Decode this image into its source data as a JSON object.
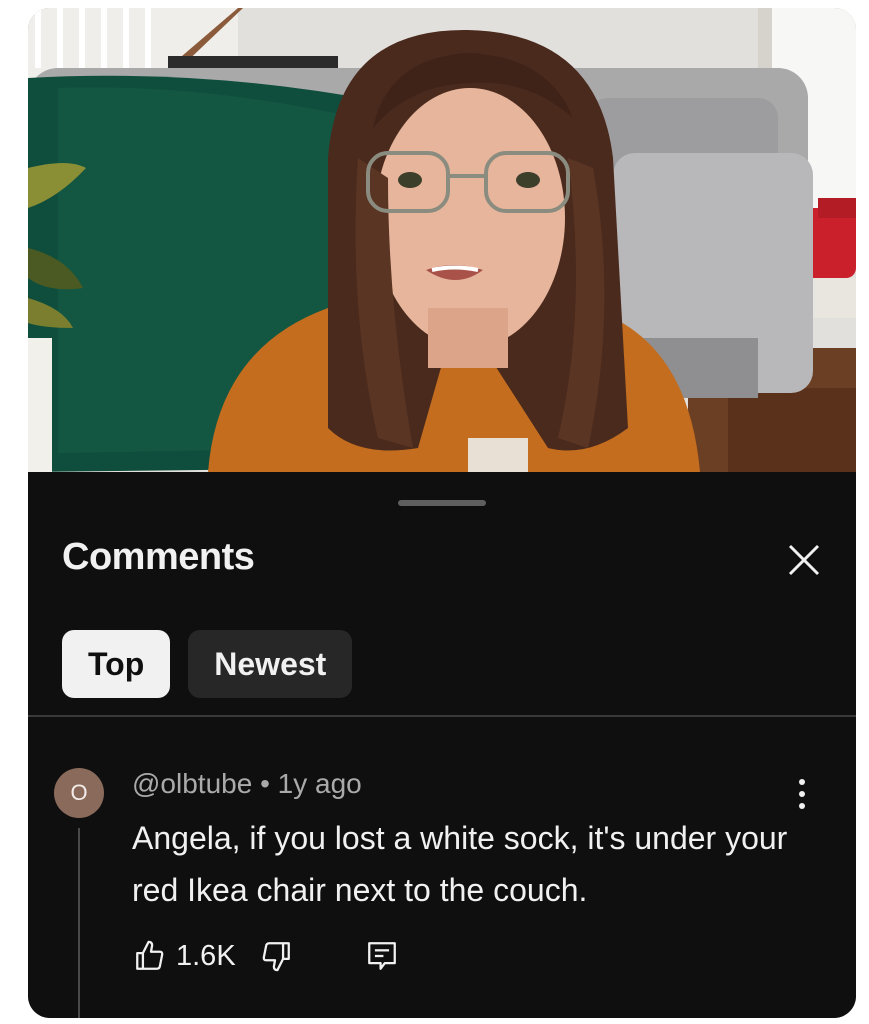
{
  "sheet": {
    "title": "Comments",
    "close_icon": "close-icon"
  },
  "sort_chips": [
    {
      "label": "Top",
      "selected": true
    },
    {
      "label": "Newest",
      "selected": false
    }
  ],
  "comment": {
    "avatar_letter": "O",
    "author": "@olbtube",
    "separator": "•",
    "time": "1y ago",
    "text": "Angela, if you lost a white sock, it's under your red Ikea chair next to the couch.",
    "likes": "1.6K",
    "icons": [
      "thumbs-up-icon",
      "thumbs-down-icon",
      "reply-icon",
      "more-vert-icon"
    ]
  },
  "colors": {
    "sheet_bg": "#0f0f0f",
    "text_primary": "#f1f1f1",
    "text_secondary": "#aaaaaa",
    "chip_active_bg": "#f1f1f1",
    "chip_inactive_bg": "#272727",
    "avatar_bg": "#8a6a5b"
  }
}
